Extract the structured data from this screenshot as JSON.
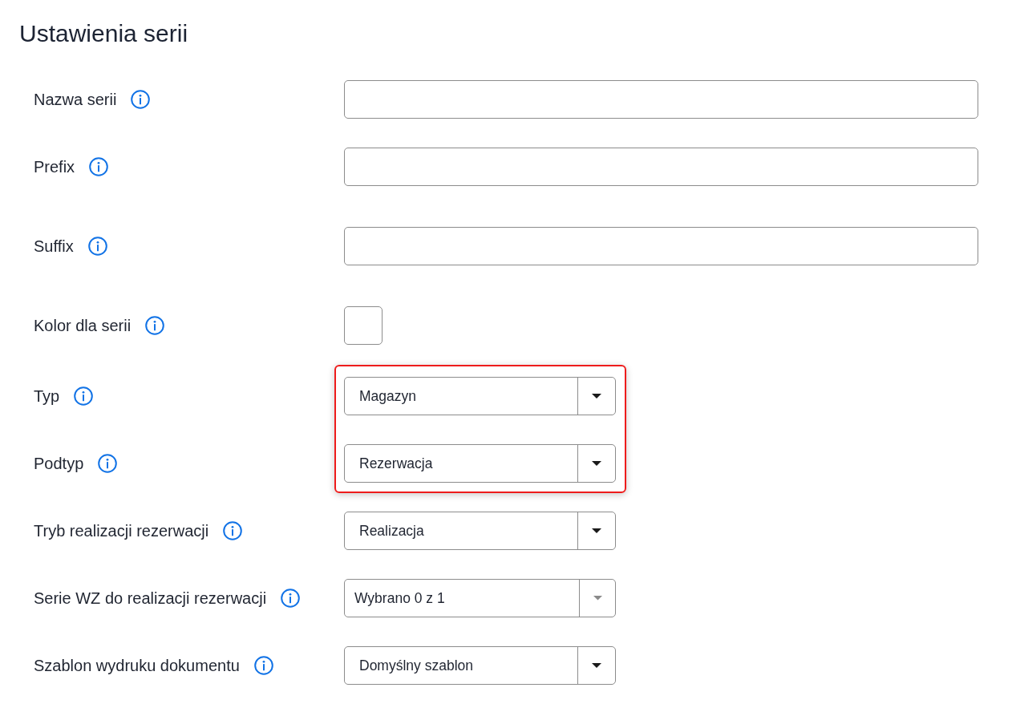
{
  "title": "Ustawienia serii",
  "fields": [
    {
      "label": "Nazwa serii",
      "kind": "text",
      "highlighted": false
    },
    {
      "label": "Prefix",
      "kind": "text",
      "highlighted": false
    },
    {
      "label": "Suffix",
      "kind": "text",
      "highlighted": false
    },
    {
      "label": "Kolor dla serii",
      "kind": "color",
      "highlighted": false
    },
    {
      "label": "Typ",
      "kind": "select",
      "value": "Magazyn",
      "highlighted": true
    },
    {
      "label": "Podtyp",
      "kind": "select",
      "value": "Rezerwacja",
      "highlighted": true
    },
    {
      "label": "Tryb realizacji rezerwacji",
      "kind": "select",
      "value": "Realizacja",
      "highlighted": false
    },
    {
      "label": "Serie WZ do realizacji rezerwacji",
      "kind": "multiselect",
      "value": "Wybrano 0 z 1",
      "highlighted": false
    },
    {
      "label": "Szablon wydruku dokumentu",
      "kind": "select",
      "value": "Domyślny szablon",
      "highlighted": false
    }
  ]
}
